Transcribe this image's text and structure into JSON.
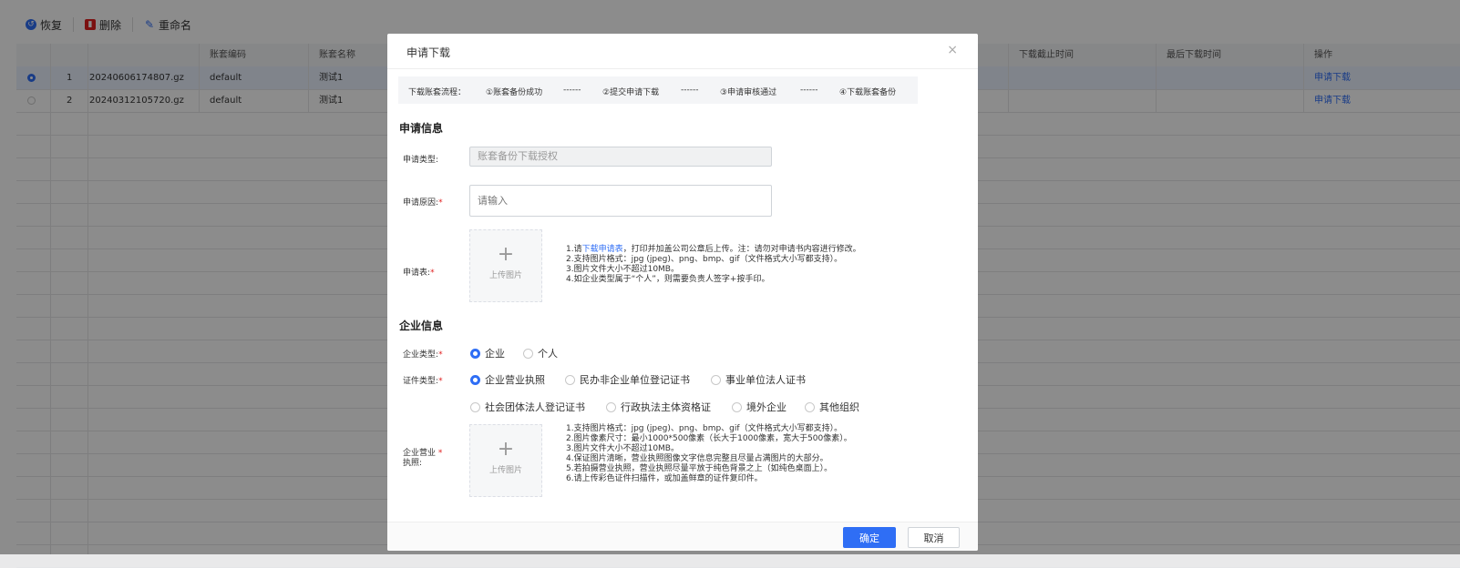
{
  "toolbar": {
    "restore_label": "恢复",
    "delete_label": "删除",
    "rename_label": "重命名"
  },
  "table": {
    "columns": [
      "账套编码",
      "账套名称",
      "下载截止时间",
      "最后下载时间",
      "操作"
    ],
    "rows": [
      {
        "index": "1",
        "file": "20240606174807.gz",
        "code": "default",
        "name": "测试1",
        "action": "申请下载",
        "selected": true
      },
      {
        "index": "2",
        "file": "20240312105720.gz",
        "code": "default",
        "name": "测试1",
        "action": "申请下载",
        "selected": false
      }
    ]
  },
  "dialog": {
    "title": "申请下载",
    "close_symbol": "×",
    "flow": {
      "label": "下载账套流程：",
      "step1": "①账套备份成功",
      "step2": "②提交申请下载",
      "step3": "③申请审核通过",
      "step4": "④下载账套备份",
      "separator": "------"
    },
    "apply_section": {
      "title": "申请信息",
      "type_label": "申请类型",
      "type_value": "账套备份下载授权",
      "reason_label": "申请原因",
      "reason_placeholder": "请输入",
      "form_label": "申请表",
      "upload_text": "上传图片",
      "hint1_prefix": "1.请",
      "hint1_link": "下载申请表",
      "hint1_suffix": "，打印并加盖公司公章后上传。注：请勿对申请书内容进行修改。",
      "hint2": "2.支持图片格式：jpg (jpeg)、png、bmp、gif（文件格式大小写都支持）。",
      "hint3": "3.图片文件大小不超过10MB。",
      "hint4": "4.如企业类型属于“个人”，则需要负责人签字+按手印。"
    },
    "company_section": {
      "title": "企业信息",
      "company_type_label": "企业类型",
      "company_types": [
        "企业",
        "个人"
      ],
      "cert_type_label": "证件类型",
      "cert_types_row1": [
        "企业营业执照",
        "民办非企业单位登记证书",
        "事业单位法人证书"
      ],
      "cert_types_row2": [
        "社会团体法人登记证书",
        "行政执法主体资格证",
        "境外企业",
        "其他组织"
      ],
      "license_label_line1": "企业营业",
      "license_label_line2": "执照",
      "upload_text": "上传图片",
      "hints": [
        "1.支持图片格式：jpg (jpeg)、png、bmp、gif（文件格式大小写都支持）。",
        "2.图片像素尺寸：最小1000*500像素（长大于1000像素，宽大于500像素）。",
        "3.图片文件大小不超过10MB。",
        "4.保证图片清晰，营业执照图像文字信息完整且尽量占满图片的大部分。",
        "5.若拍摄营业执照，营业执照尽量平放于纯色背景之上（如纯色桌面上）。",
        "6.请上传彩色证件扫描件，或加盖鲜章的证件复印件。"
      ]
    },
    "buttons": {
      "ok": "确定",
      "cancel": "取消"
    },
    "required_mark": "*",
    "colon": ":"
  },
  "colors": {
    "primary": "#2f6ef5",
    "required": "#e02020",
    "delete_icon": "#e02020",
    "restore_icon": "#2f6ef5"
  }
}
